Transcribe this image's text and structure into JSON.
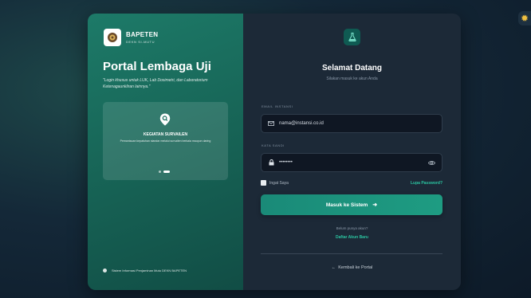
{
  "brand": {
    "title": "BAPETEN",
    "subtitle": "DEKN SI-MUTU"
  },
  "left": {
    "portal_title": "Portal Lembaga Uji",
    "quote": "\"Login khusus untuk LUK, Lab Dosimetri, dan Laboratorium Ketenagaunkliran lainnya.\"",
    "promo": {
      "icon": "search-pin-icon",
      "title": "KEGIATAN SURVAILEN",
      "description": "Pemantauan kepatuhan standar melalui survailen berkala maupun daring"
    },
    "slides_total": 2,
    "slides_active": 2,
    "footer": "Sistem Informasi Penjaminan Mutu DEKN BAPETEN"
  },
  "right": {
    "icon": "flask-icon",
    "welcome": "Selamat Datang",
    "welcome_sub": "Silakan masuk ke akun Anda",
    "email": {
      "label": "EMAIL INSTANSI",
      "placeholder": "nama@instansi.co.id",
      "icon": "mail-icon"
    },
    "password": {
      "label": "KATA SANDI",
      "value": "••••••••",
      "icon": "lock-icon",
      "toggle_icon": "eye-icon"
    },
    "remember_label": "Ingat Saya",
    "forgot_label": "Lupa Password?",
    "submit_label": "Masuk ke Sistem",
    "no_account": "Belum punya akun?",
    "register_label": "Daftar Akun Baru",
    "back_label": "Kembali ke Portal"
  },
  "theme_toggle_icon": "sun-icon",
  "colors": {
    "accent": "#2bc4a0",
    "left_panel": "#176456",
    "right_panel": "#1c2937",
    "button": "#1e9c82"
  }
}
